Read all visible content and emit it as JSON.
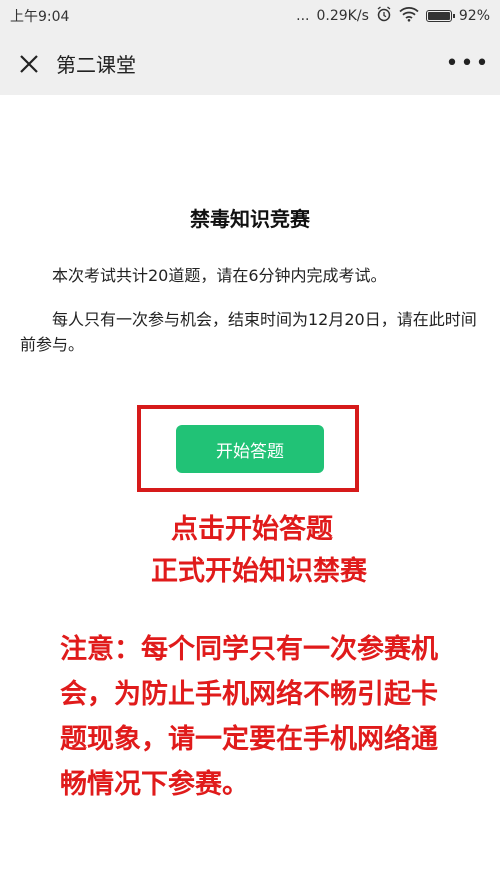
{
  "status_bar": {
    "time": "上午9:04",
    "dots": "...",
    "network_speed": "0.29K/s",
    "battery_percent": "92%",
    "battery_level": 0.92
  },
  "navbar": {
    "title": "第二课堂",
    "close_icon": "close-icon",
    "more_icon": "more-icon",
    "more_label": "•••"
  },
  "page": {
    "title": "禁毒知识竞赛",
    "para1": "本次考试共计20道题，请在6分钟内完成考试。",
    "para2": "每人只有一次参与机会，结束时间为12月20日，请在此时间前参与。",
    "start_button": "开始答题"
  },
  "annotation": {
    "hint_line1": "点击开始答题",
    "hint_line2": "正式开始知识禁赛",
    "notice": "注意：每个同学只有一次参赛机会，为防止手机网络不畅引起卡题现象，请一定要在手机网络通畅情况下参赛。",
    "color": "#e01b1b"
  },
  "colors": {
    "button": "#21c276",
    "frame": "#d61a1a",
    "header_bg": "#efefef"
  }
}
